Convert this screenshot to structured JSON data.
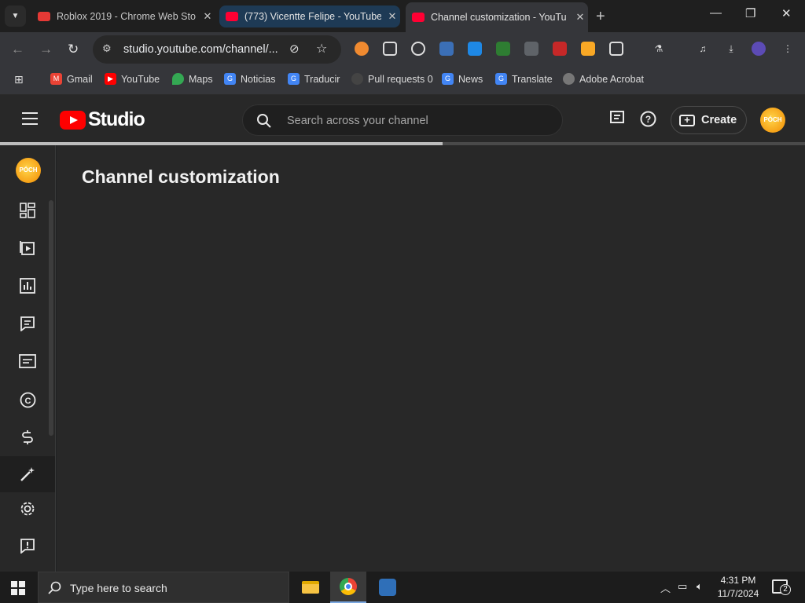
{
  "browser": {
    "tabs": [
      {
        "title": "Roblox 2019 - Chrome Web Sto",
        "favicon_color": "#e53935"
      },
      {
        "title": "(773) Vicentte Felipe - YouTube",
        "favicon_color": "#ff0033"
      },
      {
        "title": "Channel customization - YouTu",
        "favicon_color": "#ff0033"
      }
    ],
    "url": "studio.youtube.com/channel/...",
    "bookmarks": [
      {
        "label": "Gmail",
        "color": "#ea4335"
      },
      {
        "label": "YouTube",
        "color": "#ff0000"
      },
      {
        "label": "Maps",
        "color": "#34a853"
      },
      {
        "label": "Noticias",
        "color": "#4285f4"
      },
      {
        "label": "Traducir",
        "color": "#4285f4"
      },
      {
        "label": "Pull requests 0",
        "color": "#444444"
      },
      {
        "label": "News",
        "color": "#4285f4"
      },
      {
        "label": "Translate",
        "color": "#4285f4"
      },
      {
        "label": "Adobe Acrobat",
        "color": "#777777"
      }
    ]
  },
  "studio": {
    "logo_text": "Studio",
    "search_placeholder": "Search across your channel",
    "create_label": "Create",
    "page_title": "Channel customization",
    "avatar_text": "PÓCH",
    "loading_progress": 0.55
  },
  "sidebar": {
    "items": [
      "dashboard",
      "content",
      "analytics",
      "comments",
      "subtitles",
      "copyright",
      "earn",
      "customization",
      "settings",
      "feedback"
    ]
  },
  "taskbar": {
    "search_text": "Type here to search",
    "time": "4:31 PM",
    "date": "11/7/2024",
    "notification_count": "2"
  }
}
